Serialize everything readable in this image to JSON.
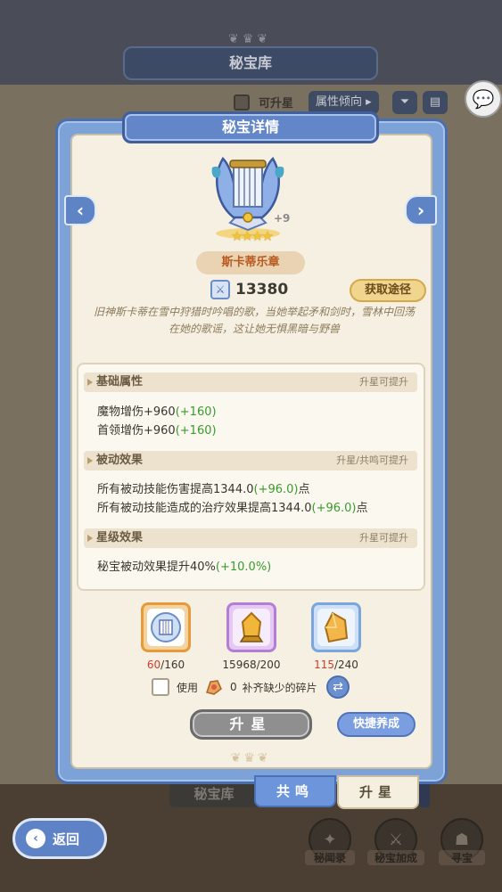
{
  "background": {
    "header_title": "秘宝库",
    "upgradeable_label": "可升星",
    "attribute_filter_label": "属性倾向",
    "library_tab_label": "秘宝库"
  },
  "modal": {
    "title": "秘宝详情",
    "artifact": {
      "level_badge": "+9",
      "stars": "★★★★",
      "name": "斯卡蒂乐章",
      "power": "13380",
      "obtain_button": "获取途径",
      "description": "旧神斯卡蒂在雪中狩猎时吟唱的歌，当她举起矛和剑时，雪林中回荡在她的歌谣，这让她无惧黑暗与野兽"
    },
    "sections": {
      "basic": {
        "title": "基础属性",
        "note": "升星可提升",
        "lines": [
          {
            "text": "魔物增伤+960",
            "bonus": "(+160)"
          },
          {
            "text": "首领增伤+960",
            "bonus": "(+160)"
          }
        ]
      },
      "passive": {
        "title": "被动效果",
        "note": "升星/共鸣可提升",
        "lines": [
          {
            "text": "所有被动技能伤害提高1344.0",
            "bonus": "(+96.0)",
            "suffix": "点"
          },
          {
            "text": "所有被动技能造成的治疗效果提高1344.0",
            "bonus": "(+96.0)",
            "suffix": "点"
          }
        ]
      },
      "star": {
        "title": "星级效果",
        "note": "升星可提升",
        "lines": [
          {
            "text": "秘宝被动效果提升40%",
            "bonus": "(+10.0%)"
          }
        ]
      }
    },
    "materials": [
      {
        "have": "60",
        "need": "/160",
        "insufficient": true
      },
      {
        "have": "15968",
        "need": "/200",
        "insufficient": false
      },
      {
        "have": "115",
        "need": "/240",
        "insufficient": true
      }
    ],
    "use_fragments": {
      "label_use": "使用",
      "count": "0",
      "label_rest": "补齐缺少的碎片"
    },
    "upgrade_button": "升星",
    "quick_button": "快捷养成",
    "tabs": {
      "resonate": "共鸣",
      "upstar": "升星"
    }
  },
  "bottom_nav": {
    "back_label": "返回",
    "items": [
      {
        "label": "秘闻录"
      },
      {
        "label": "秘宝加成"
      },
      {
        "label": "寻宝"
      }
    ]
  },
  "colors": {
    "accent_blue": "#6386c8",
    "bonus_green": "#3a9a2e",
    "insufficient_red": "#d23a2a",
    "star_gold": "#f2c43e"
  }
}
